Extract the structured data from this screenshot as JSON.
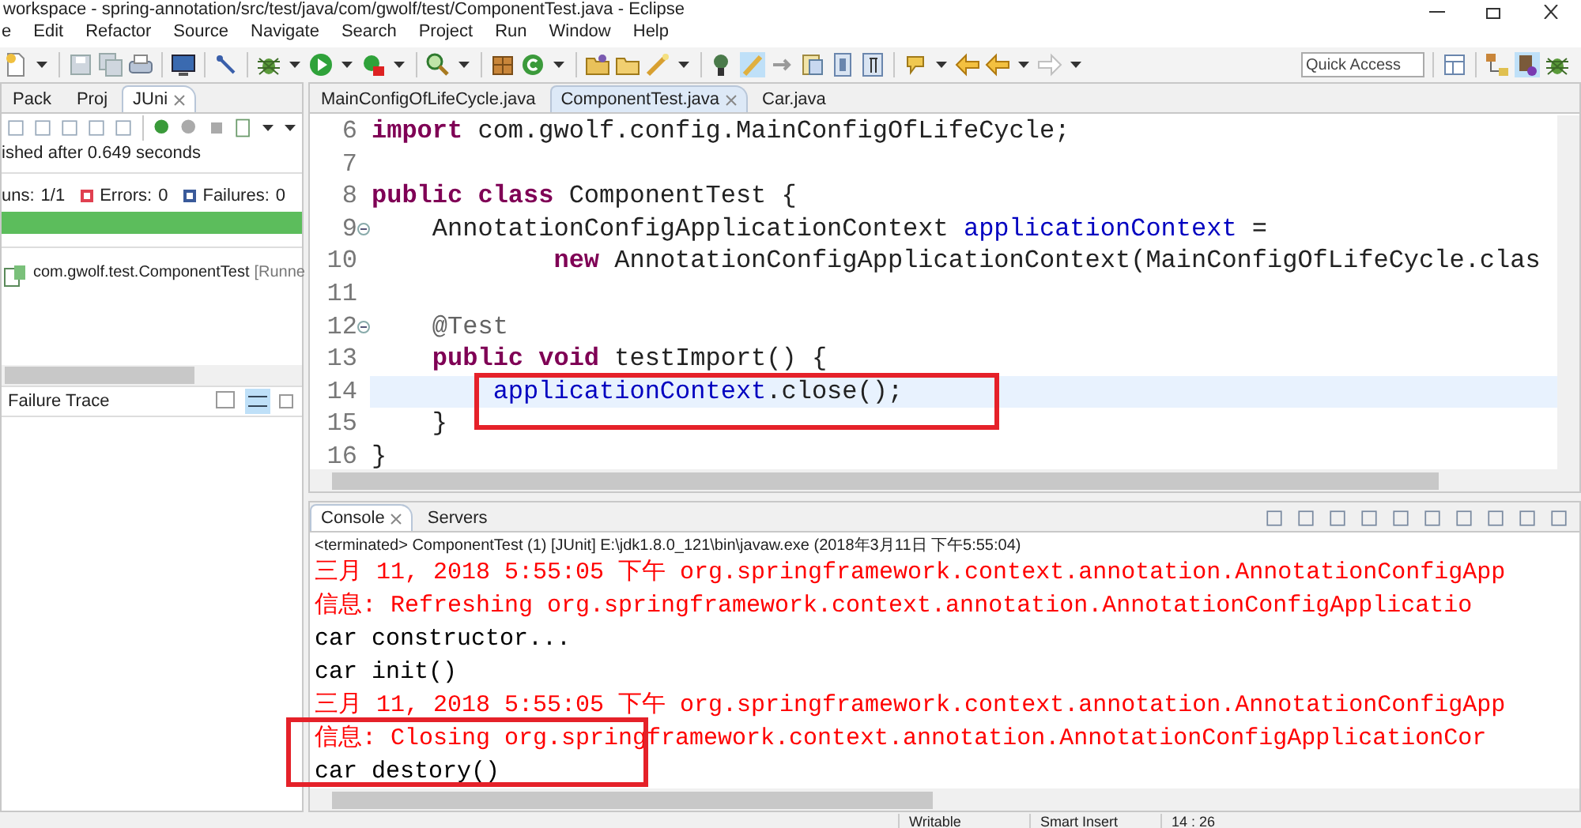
{
  "window": {
    "title": "workspace - spring-annotation/src/test/java/com/gwolf/test/ComponentTest.java - Eclipse"
  },
  "menu": [
    "e",
    "Edit",
    "Refactor",
    "Source",
    "Navigate",
    "Search",
    "Project",
    "Run",
    "Window",
    "Help"
  ],
  "toolbar": {
    "quick_access": {
      "placeholder": "Quick Access"
    }
  },
  "left_panel": {
    "tabs": [
      {
        "label": "Pack",
        "selected": false
      },
      {
        "label": "Proj",
        "selected": false
      },
      {
        "label": "JUni",
        "selected": true
      }
    ],
    "status": "ished after 0.649 seconds",
    "counters": [
      {
        "kind": "runs",
        "label": "uns:",
        "value": "1/1"
      },
      {
        "kind": "errors",
        "label": "Errors:",
        "value": "0"
      },
      {
        "kind": "failures",
        "label": "Failures:",
        "value": "0"
      }
    ],
    "progress": {
      "level": 1,
      "failed": false
    },
    "tree": [
      {
        "label": "com.gwolf.test.ComponentTest",
        "detail": "[Runne"
      }
    ],
    "failure_trace": {
      "title": "Failure Trace"
    }
  },
  "editor": {
    "tabs": [
      {
        "label": "MainConfigOfLifeCycle.java",
        "selected": false
      },
      {
        "label": "ComponentTest.java",
        "selected": true
      },
      {
        "label": "Car.java",
        "selected": false
      }
    ],
    "lines": [
      {
        "number": "6",
        "current": false,
        "foldable": false,
        "tokens": [
          {
            "text": "import",
            "kind": "keyword"
          },
          {
            "text": " com.gwolf.config.MainConfigOfLifeCycle;",
            "kind": "plain"
          }
        ]
      },
      {
        "number": "7",
        "current": false,
        "foldable": false
      },
      {
        "number": "8",
        "current": false,
        "foldable": false,
        "tokens": [
          {
            "text": "public class",
            "kind": "keyword"
          },
          {
            "text": " ComponentTest {",
            "kind": "plain"
          }
        ]
      },
      {
        "number": "9",
        "current": false,
        "foldable": true,
        "tokens": [
          {
            "text": "    AnnotationConfigApplicationContext ",
            "kind": "plain"
          },
          {
            "text": "applicationContext",
            "kind": "field"
          },
          {
            "text": " =",
            "kind": "plain"
          }
        ]
      },
      {
        "number": "10",
        "current": false,
        "foldable": false,
        "tokens": [
          {
            "text": "            new",
            "kind": "keyword"
          },
          {
            "text": " AnnotationConfigApplicationContext(MainConfigOfLifeCycle.clas",
            "kind": "plain"
          }
        ]
      },
      {
        "number": "11",
        "current": false,
        "foldable": false
      },
      {
        "number": "12",
        "current": false,
        "foldable": true,
        "tokens": [
          {
            "text": "    @Test",
            "kind": "annotation"
          }
        ]
      },
      {
        "number": "13",
        "current": false,
        "foldable": false,
        "tokens": [
          {
            "text": "    public void",
            "kind": "keyword"
          },
          {
            "text": " testImport() {",
            "kind": "plain"
          }
        ]
      },
      {
        "number": "14",
        "current": true,
        "foldable": false,
        "tokens": [
          {
            "text": "        applicationContext",
            "kind": "field"
          },
          {
            "text": ".close();",
            "kind": "plain"
          }
        ]
      },
      {
        "number": "15",
        "current": false,
        "foldable": false,
        "tokens": [
          {
            "text": "    }",
            "kind": "plain"
          }
        ]
      },
      {
        "number": "16",
        "current": false,
        "foldable": false,
        "tokens": [
          {
            "text": "}",
            "kind": "plain"
          }
        ]
      }
    ]
  },
  "console": {
    "tabs": [
      {
        "label": "Console",
        "selected": true
      },
      {
        "label": "Servers",
        "selected": false
      }
    ],
    "header": "<terminated> ComponentTest (1) [JUnit] E:\\jdk1.8.0_121\\bin\\javaw.exe (2018年3月11日 下午5:55:04)",
    "lines": [
      {
        "kind": "stderr",
        "text": "三月 11, 2018 5:55:05 下午 org.springframework.context.annotation.AnnotationConfigApp"
      },
      {
        "kind": "stderr",
        "text": "信息: Refreshing org.springframework.context.annotation.AnnotationConfigApplicatio"
      },
      {
        "kind": "stdout",
        "text": "car constructor..."
      },
      {
        "kind": "stdout",
        "text": "car init()"
      },
      {
        "kind": "stderr",
        "text": "三月 11, 2018 5:55:05 下午 org.springframework.context.annotation.AnnotationConfigApp"
      },
      {
        "kind": "stderr",
        "text": "信息: Closing org.springframework.context.annotation.AnnotationConfigApplicationCor"
      },
      {
        "kind": "stdout",
        "text": "car destory()"
      }
    ]
  },
  "status_bar": [
    "Writable",
    "Smart Insert",
    "14 : 26"
  ],
  "annotations": [
    {
      "kind": "rectangle",
      "color": "#e52129"
    },
    {
      "kind": "rectangle",
      "color": "#e52129"
    }
  ]
}
